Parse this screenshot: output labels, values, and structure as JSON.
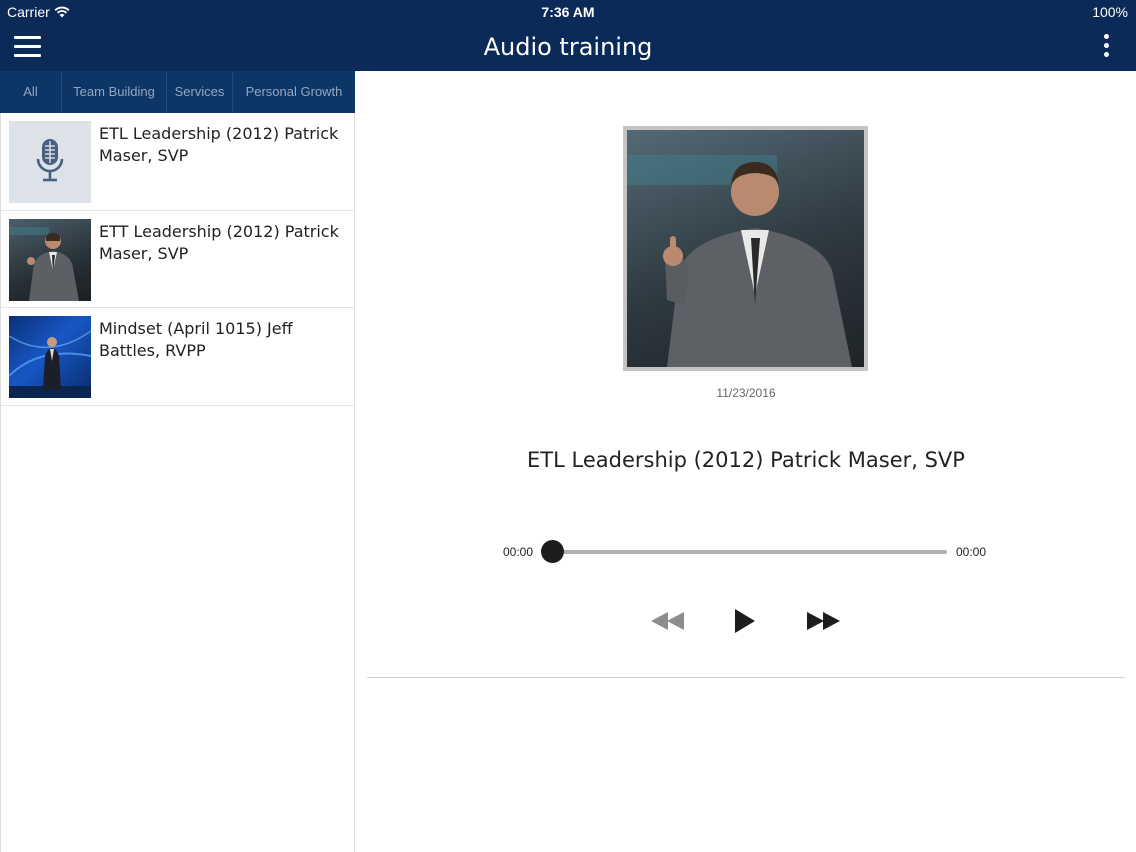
{
  "status_bar": {
    "carrier": "Carrier",
    "time": "7:36 AM",
    "battery": "100%"
  },
  "header": {
    "title": "Audio training",
    "menu_icon": "hamburger-icon",
    "more_icon": "more-vertical-icon"
  },
  "tabs": [
    {
      "label": "All"
    },
    {
      "label": "Team Building"
    },
    {
      "label": "Services"
    },
    {
      "label": "Personal Growth"
    }
  ],
  "list": {
    "items": [
      {
        "title": "ETL Leadership (2012) Patrick Maser, SVP",
        "thumb": "microphone-icon"
      },
      {
        "title": "ETT Leadership (2012) Patrick Maser, SVP",
        "thumb": "speaker-photo"
      },
      {
        "title": "Mindset (April 1015) Jeff Battles, RVPP",
        "thumb": "stage-photo"
      }
    ]
  },
  "player": {
    "date": "11/23/2016",
    "title": "ETL Leadership (2012) Patrick Maser, SVP",
    "elapsed": "00:00",
    "duration": "00:00",
    "progress": 0,
    "controls": [
      "rewind-icon",
      "play-icon",
      "fast-forward-icon"
    ]
  },
  "colors": {
    "header_bg": "#0c2a57",
    "tabs_bg": "#0c3665",
    "tab_text": "#93a6c0"
  }
}
